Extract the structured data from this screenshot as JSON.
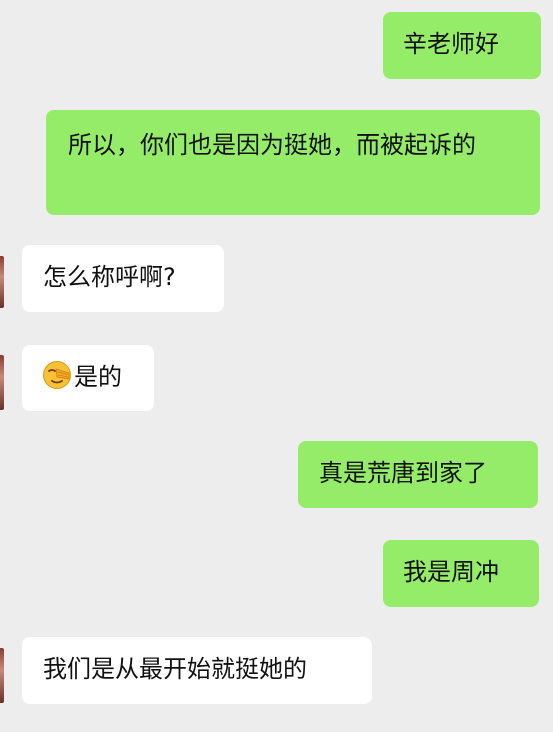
{
  "messages": [
    {
      "id": "m1",
      "side": "sent",
      "text": "辛老师好"
    },
    {
      "id": "m2",
      "side": "sent",
      "text": "所以，你们也是因为挺她，而被起诉的"
    },
    {
      "id": "m3",
      "side": "received",
      "text": "怎么称呼啊?"
    },
    {
      "id": "m4",
      "side": "received",
      "emoji": "facepalm-emoji",
      "text": "是的"
    },
    {
      "id": "m5",
      "side": "sent",
      "text": "真是荒唐到家了"
    },
    {
      "id": "m6",
      "side": "sent",
      "text": "我是周冲"
    },
    {
      "id": "m7",
      "side": "received",
      "text": "我们是从最开始就挺她的"
    }
  ],
  "colors": {
    "background": "#ededed",
    "sent_bubble": "#95ec69",
    "received_bubble": "#ffffff",
    "text": "#111111"
  }
}
